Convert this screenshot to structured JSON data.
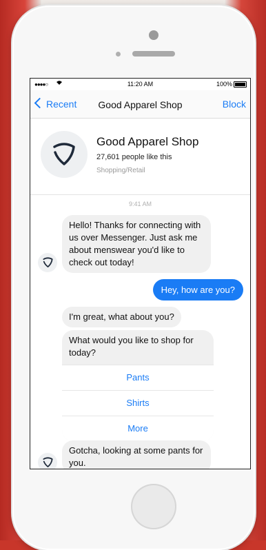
{
  "status_bar": {
    "signal": "●●●●○",
    "time": "11:20 AM",
    "battery": "100%"
  },
  "nav": {
    "back_label": "Recent",
    "title": "Good Apparel Shop",
    "block_label": "Block"
  },
  "profile": {
    "name": "Good Apparel Shop",
    "likes": "27,601 people like this",
    "category": "Shopping/Retail"
  },
  "conversation": {
    "timestamp": "9:41 AM",
    "greeting": "Hello! Thanks for connecting with us over Messenger. Just ask me about menswear you'd like to check out today!",
    "user_message": "Hey, how are you?",
    "reply": "I'm great, what about you?",
    "question": "What would you like to shop for today?",
    "quick_replies": [
      "Pants",
      "Shirts",
      "More"
    ],
    "followup": "Gotcha, looking at some pants for you."
  },
  "colors": {
    "accent": "#1a7cf5",
    "bubble_incoming": "#f0f0f0",
    "logo": "#1f2a3a"
  }
}
